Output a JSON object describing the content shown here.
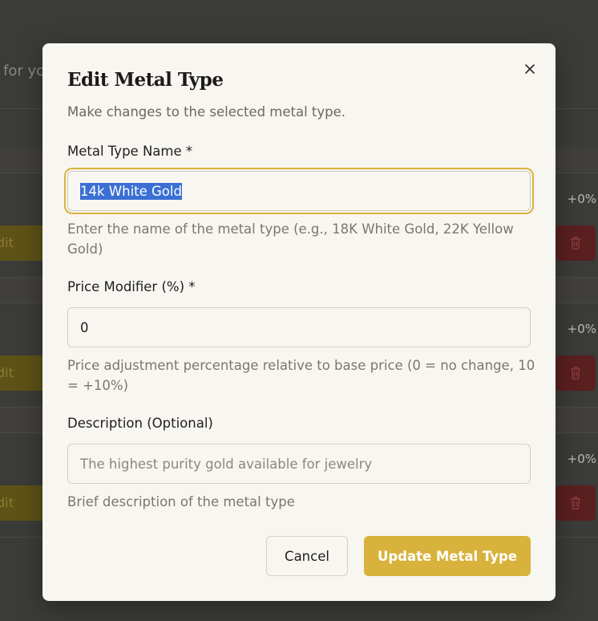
{
  "background": {
    "subtitle_fragment": "for yo",
    "edit_label_fragment": "dit",
    "rows": [
      {
        "price_modifier": "+0%"
      },
      {
        "price_modifier": "+0%"
      },
      {
        "price_modifier": "+0%"
      }
    ]
  },
  "modal": {
    "title": "Edit Metal Type",
    "description": "Make changes to the selected metal type.",
    "close_icon": "close-icon",
    "fields": {
      "name": {
        "label": "Metal Type Name *",
        "value": "14k White Gold",
        "helper": "Enter the name of the metal type (e.g., 18K White Gold, 22K Yellow Gold)"
      },
      "price_modifier": {
        "label": "Price Modifier (%) *",
        "value": "0",
        "helper": "Price adjustment percentage relative to base price (0 = no change, 10 = +10%)"
      },
      "description": {
        "label": "Description (Optional)",
        "placeholder": "The highest purity gold available for jewelry",
        "helper": "Brief description of the metal type"
      }
    },
    "buttons": {
      "cancel": "Cancel",
      "submit": "Update Metal Type"
    }
  },
  "colors": {
    "accent": "#d8b23c",
    "overlay": "#3b3b39",
    "modal_bg": "#f8f6f1",
    "danger": "#5a1f1f"
  }
}
